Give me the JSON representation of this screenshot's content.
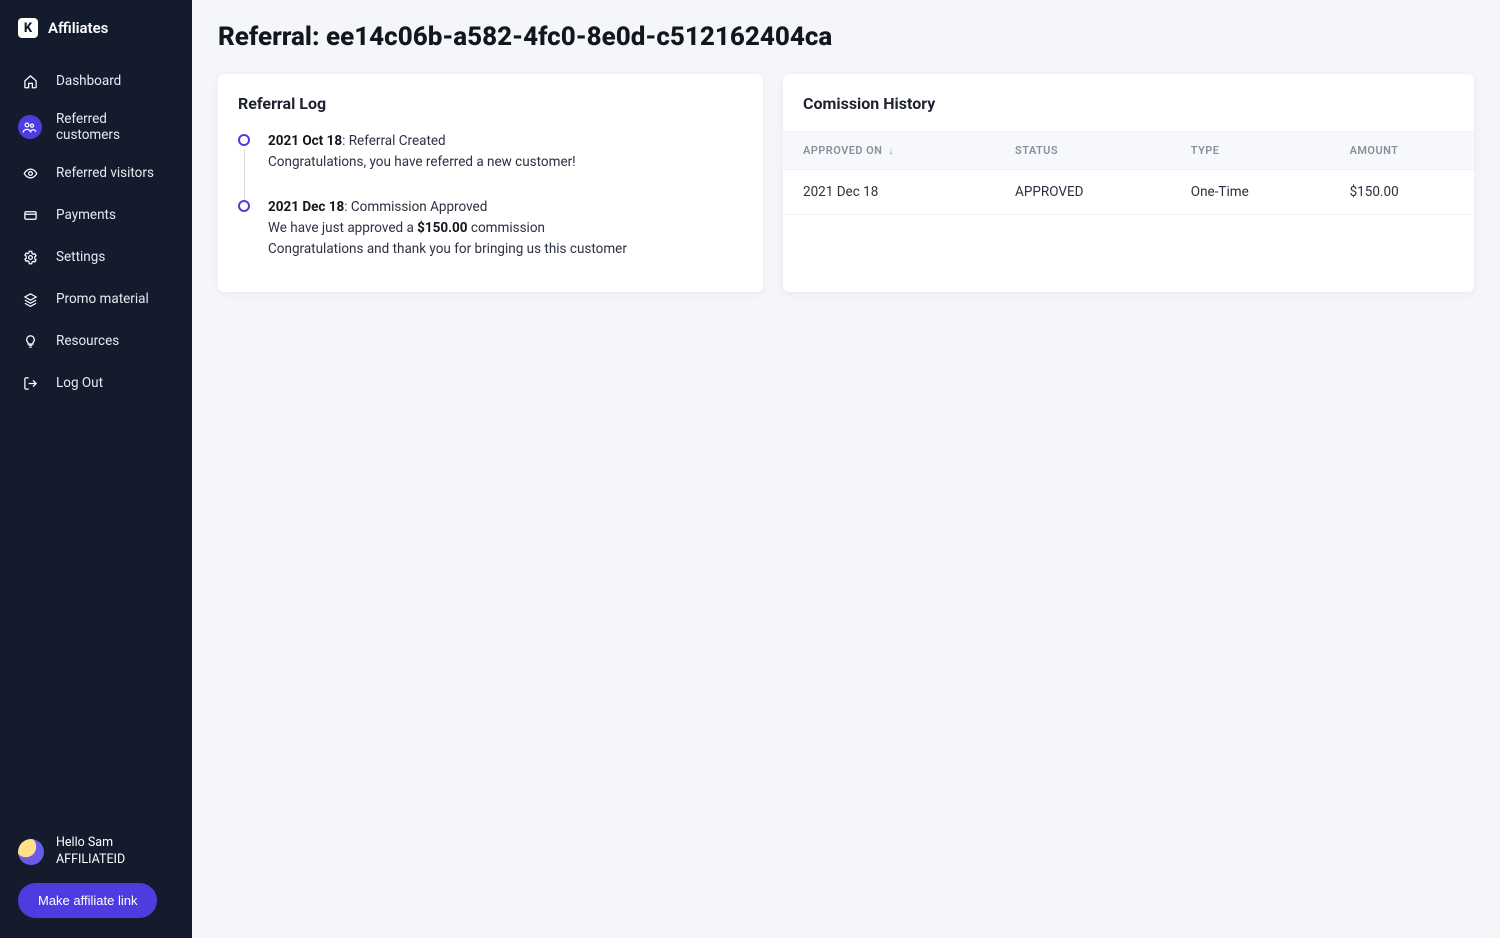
{
  "brand": {
    "logo_letter": "K",
    "name": "Affiliates"
  },
  "sidebar": {
    "items": [
      {
        "label": "Dashboard",
        "icon": "home-icon",
        "active": false
      },
      {
        "label": "Referred customers",
        "icon": "users-icon",
        "active": true
      },
      {
        "label": "Referred visitors",
        "icon": "eye-icon",
        "active": false
      },
      {
        "label": "Payments",
        "icon": "card-icon",
        "active": false
      },
      {
        "label": "Settings",
        "icon": "gear-icon",
        "active": false
      },
      {
        "label": "Promo material",
        "icon": "layers-icon",
        "active": false
      },
      {
        "label": "Resources",
        "icon": "bulb-icon",
        "active": false
      },
      {
        "label": "Log Out",
        "icon": "logout-icon",
        "active": false
      }
    ],
    "user_greeting": "Hello Sam",
    "user_sub": "AFFILIATEID",
    "cta_label": "Make affiliate link"
  },
  "page": {
    "title": "Referral: ee14c06b-a582-4fc0-8e0d-c512162404ca"
  },
  "referral_log": {
    "title": "Referral Log",
    "entries": [
      {
        "date": "2021 Oct 18",
        "headline_suffix": ": Referral Created",
        "lines": [
          "Congratulations, you have referred a new customer!"
        ]
      },
      {
        "date": "2021 Dec 18",
        "headline_suffix": ": Commission Approved",
        "line_prefix": "We have just approved a ",
        "amount": "$150.00",
        "line_suffix": " commission",
        "extra_line": "Congratulations and thank you for bringing us this customer"
      }
    ]
  },
  "commission_history": {
    "title": "Comission History",
    "columns": [
      "APPROVED ON",
      "STATUS",
      "TYPE",
      "AMOUNT"
    ],
    "sort_indicator": "↓",
    "rows": [
      {
        "approved_on": "2021 Dec 18",
        "status": "APPROVED",
        "type": "One-Time",
        "amount": "$150.00"
      }
    ]
  }
}
